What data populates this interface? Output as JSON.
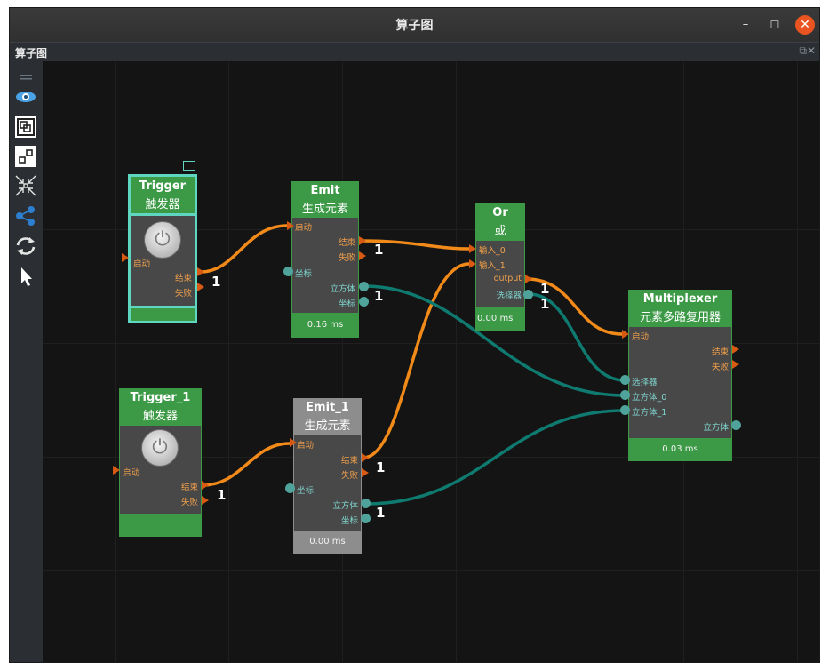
{
  "window": {
    "title": "算子图",
    "minimize": "–",
    "maximize": "☐",
    "close": "✕"
  },
  "dock": {
    "title": "算子图",
    "buttons": "⧉✕"
  },
  "toolbar": {
    "items": [
      {
        "name": "handle-icon",
        "glyph": "═"
      },
      {
        "name": "eye-icon",
        "glyph": "◉"
      },
      {
        "name": "fit-view-icon",
        "glyph": "⧉"
      },
      {
        "name": "node-icon",
        "glyph": "⊡"
      },
      {
        "name": "collapse-icon",
        "glyph": "⤡"
      },
      {
        "name": "share-graph-icon",
        "glyph": "⋖"
      },
      {
        "name": "refresh-icon",
        "glyph": "⟳"
      },
      {
        "name": "pointer-icon",
        "glyph": "➤"
      }
    ]
  },
  "nodes": {
    "trigger": {
      "title": "Trigger",
      "subtitle": "触发器",
      "in_start": "启动",
      "out_end": "结束",
      "out_fail": "失败"
    },
    "trigger1": {
      "title": "Trigger_1",
      "subtitle": "触发器",
      "in_start": "启动",
      "out_end": "结束",
      "out_fail": "失败"
    },
    "emit": {
      "title": "Emit",
      "subtitle": "生成元素",
      "in_start": "启动",
      "in_coord": "坐标",
      "out_end": "结束",
      "out_fail": "失败",
      "out_cube": "立方体",
      "out_coord": "坐标",
      "time": "0.16 ms"
    },
    "emit1": {
      "title": "Emit_1",
      "subtitle": "生成元素",
      "in_start": "启动",
      "in_coord": "坐标",
      "out_end": "结束",
      "out_fail": "失败",
      "out_cube": "立方体",
      "out_coord": "坐标",
      "time": "0.00 ms"
    },
    "or": {
      "title": "Or",
      "subtitle": "或",
      "in0": "输入_0",
      "in1": "输入_1",
      "out": "output",
      "out_sel": "选择器",
      "time": "0.00 ms"
    },
    "mux": {
      "title": "Multiplexer",
      "subtitle": "元素多路复用器",
      "in_start": "启动",
      "in_sel": "选择器",
      "in_cube0": "立方体_0",
      "in_cube1": "立方体_1",
      "out_end": "结束",
      "out_fail": "失败",
      "out_cube": "立方体",
      "time": "0.03 ms"
    }
  },
  "counts": [
    "1",
    "1",
    "1",
    "1",
    "1",
    "1",
    "1",
    "1",
    "1"
  ],
  "colors": {
    "orange_wire": "#f28a1a",
    "teal_wire": "#0f7a70",
    "node_green": "#3c9a46",
    "node_gray": "#8d8d8d",
    "selected": "#5fd7c0"
  }
}
